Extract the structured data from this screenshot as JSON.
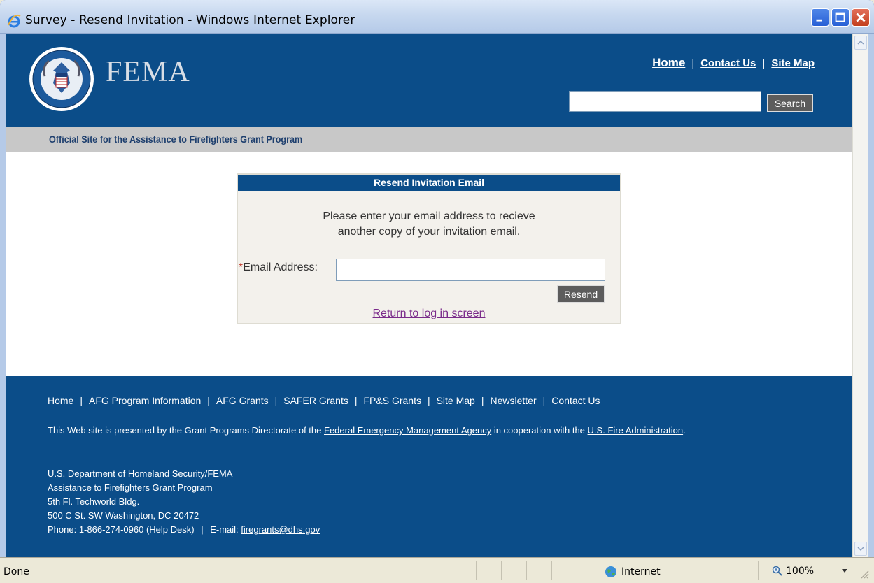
{
  "window": {
    "title": "Survey - Resend Invitation - Windows Internet Explorer"
  },
  "header": {
    "logo_text": "FEMA",
    "nav": {
      "home": "Home",
      "contact": "Contact Us",
      "sitemap": "Site Map",
      "separator": "|"
    },
    "search": {
      "value": "",
      "button_label": "Search"
    },
    "tagline": "Official Site for the Assistance to Firefighters Grant Program"
  },
  "panel": {
    "title": "Resend Invitation Email",
    "message_line1": "Please enter your email address to recieve",
    "message_line2": "another copy of your invitation email.",
    "required_mark": "*",
    "email_label": "Email Address:",
    "email_value": "",
    "resend_label": "Resend",
    "return_link": "Return to log in screen"
  },
  "footer": {
    "nav": [
      "Home",
      "AFG Program Information",
      "AFG Grants",
      "SAFER Grants",
      "FP&S Grants",
      "Site Map",
      "Newsletter",
      "Contact Us"
    ],
    "separator": "|",
    "statement_pre": "This Web site is presented by the Grant Programs Directorate of the",
    "statement_link1": "Federal Emergency Management Agency",
    "statement_mid": "in cooperation with the",
    "statement_link2": "U.S. Fire Administration",
    "statement_post": ".",
    "address": {
      "line1": "U.S. Department of Homeland Security/FEMA",
      "line2": "Assistance to Firefighters Grant Program",
      "line3": "5th Fl. Techworld Bldg.",
      "line4": "500 C St. SW Washington, DC 20472",
      "phone": "Phone: 1-866-274-0960 (Help Desk)",
      "email_label": "E-mail:",
      "email": "firegrants@dhs.gov"
    }
  },
  "statusbar": {
    "status": "Done",
    "zone": "Internet",
    "zoom": "100%"
  },
  "colors": {
    "brand_blue": "#0b4d89",
    "tagline_bg": "#c8c8c8",
    "button_gray": "#5c5c5c",
    "link_visited": "#7a2a8a"
  }
}
